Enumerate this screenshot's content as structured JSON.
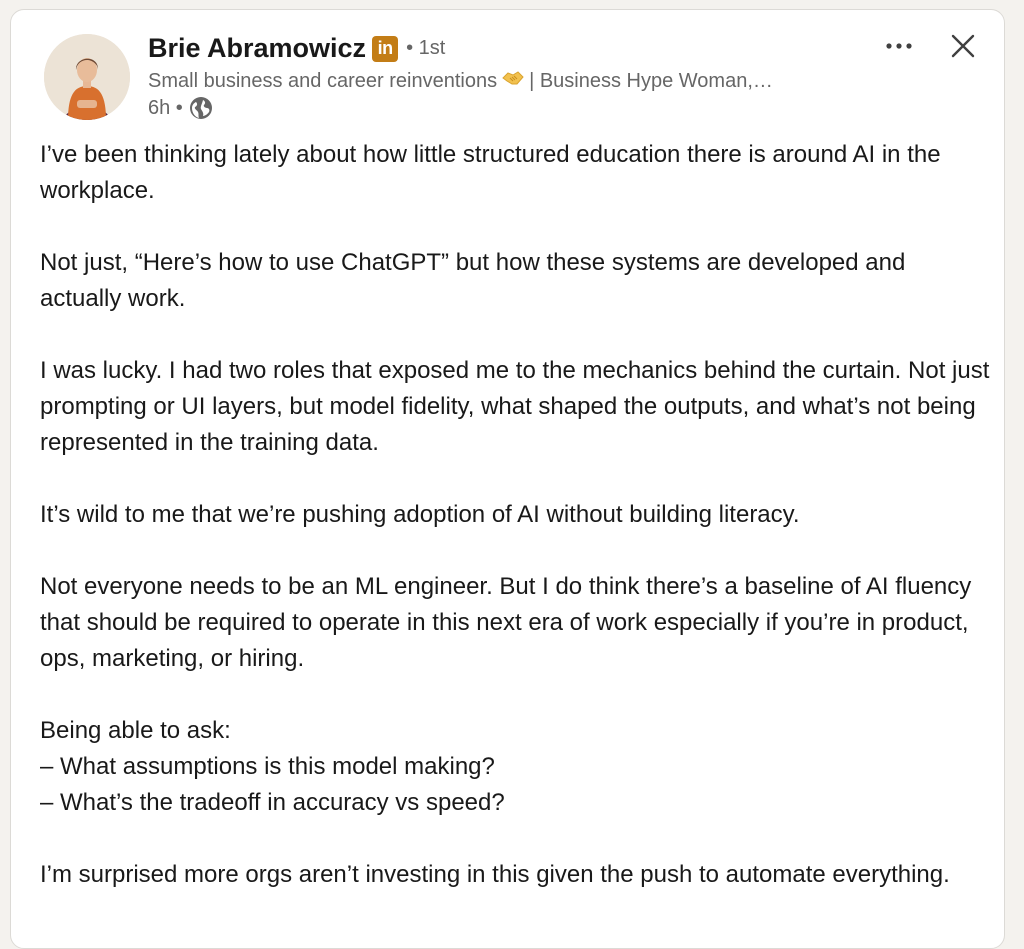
{
  "author": {
    "name": "Brie Abramowicz",
    "badge": "in",
    "degree": "• 1st",
    "headline_part1": "Small business and career reinventions",
    "headline_part2": "| Business Hype Woman,…",
    "time": "6h •"
  },
  "post": {
    "p1": "I’ve been thinking lately about how little structured education there is around AI in the workplace.",
    "p2": "Not just, “Here’s how to use ChatGPT” but how these systems are developed and actually work.",
    "p3": "I was lucky. I had two roles that exposed me to the mechanics behind the curtain. Not just prompting or UI layers, but model fidelity, what shaped the outputs, and what’s not being represented in the training data.",
    "p4": "It’s wild to me that we’re pushing adoption of AI without building literacy.",
    "p5": "Not everyone needs to be an ML engineer. But I do think there’s a baseline of AI fluency that should be required to operate in this next era of work especially if you’re in product, ops, marketing, or hiring.",
    "p6_intro": "Being able to ask:",
    "p6_item1": "– What assumptions is this model making?",
    "p6_item2": "– What’s the tradeoff in accuracy vs speed?",
    "p7": "I’m surprised more orgs aren’t investing in this given the push to automate everything."
  },
  "icons": {
    "more": "more-options-icon",
    "close": "close-icon",
    "globe": "globe-icon",
    "handshake": "handshake-icon"
  },
  "colors": {
    "text": "#191919",
    "muted": "#666666",
    "badge": "#c37d16"
  }
}
